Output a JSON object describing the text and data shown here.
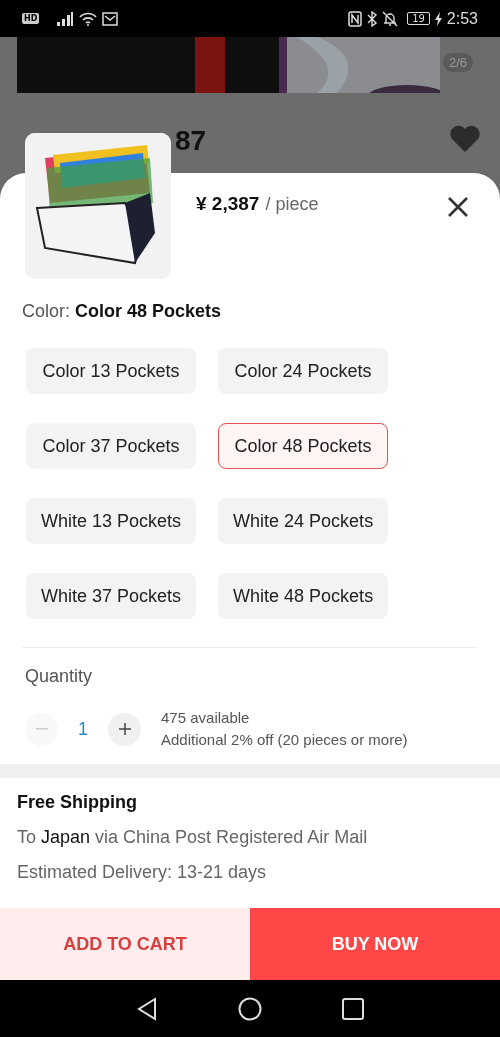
{
  "status_bar": {
    "hd": "HD",
    "battery": "19",
    "time": "2:53"
  },
  "background": {
    "page_counter": "2/6",
    "price_partial": "87",
    "favorited": true
  },
  "sheet": {
    "price": "¥ 2,387",
    "unit": "/ piece",
    "color_label": "Color:",
    "color_value": "Color 48 Pockets",
    "options": [
      {
        "label": "Color 13 Pockets",
        "selected": false
      },
      {
        "label": "Color 24 Pockets",
        "selected": false
      },
      {
        "label": "Color 37 Pockets",
        "selected": false
      },
      {
        "label": "Color 48 Pockets",
        "selected": true
      },
      {
        "label": "White 13 Pockets",
        "selected": false
      },
      {
        "label": "White 24 Pockets",
        "selected": false
      },
      {
        "label": "White 37 Pockets",
        "selected": false
      },
      {
        "label": "White 48 Pockets",
        "selected": false
      }
    ],
    "quantity_label": "Quantity",
    "quantity": "1",
    "decrease_disabled": true,
    "available": "475 available",
    "discount": "Additional 2% off (20 pieces or more)"
  },
  "shipping": {
    "title": "Free Shipping",
    "route": "To **Japan** via China Post Registered Air Mail",
    "delivery": "Estimated Delivery: 13-21 days"
  },
  "buttons": {
    "add_to_cart": "ADD TO CART",
    "buy_now": "BUY NOW"
  }
}
